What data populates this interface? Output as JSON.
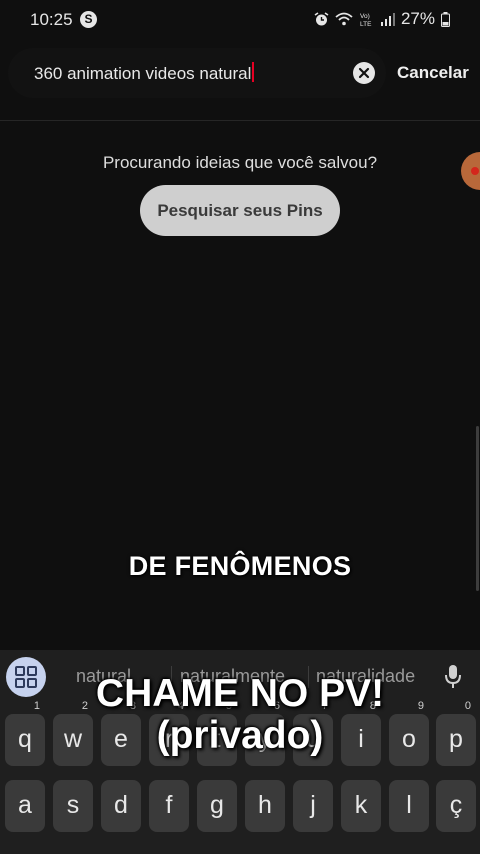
{
  "status": {
    "time": "10:25",
    "notification_badge": "S",
    "battery": "27%",
    "icons": [
      "alarm-icon",
      "wifi-icon",
      "volte-icon",
      "signal-icon",
      "battery-icon"
    ]
  },
  "search": {
    "value": "360 animation videos natural",
    "cancel_label": "Cancelar"
  },
  "content": {
    "prompt": "Procurando ideias que você salvou?",
    "search_pins_label": "Pesquisar seus Pins"
  },
  "overlay": {
    "caption_mid": "DE FENÔMENOS",
    "caption_line1": "CHAME NO PV!",
    "caption_line2": "(privado)"
  },
  "keyboard": {
    "suggestions": [
      "natural",
      "naturalmente",
      "naturalidade"
    ],
    "row1": [
      {
        "key": "q",
        "num": "1"
      },
      {
        "key": "w",
        "num": "2"
      },
      {
        "key": "e",
        "num": "3"
      },
      {
        "key": "r",
        "num": "4"
      },
      {
        "key": "t",
        "num": "5"
      },
      {
        "key": "y",
        "num": "6"
      },
      {
        "key": "u",
        "num": "7"
      },
      {
        "key": "i",
        "num": "8"
      },
      {
        "key": "o",
        "num": "9"
      },
      {
        "key": "p",
        "num": "0"
      }
    ],
    "row2": [
      "a",
      "s",
      "d",
      "f",
      "g",
      "h",
      "j",
      "k",
      "l",
      "ç"
    ]
  },
  "colors": {
    "background": "#0f0f0f",
    "caret": "#e60023",
    "pins_button": "#cfcfcf",
    "keyboard": "#1f1f1f",
    "key": "#3a3a3a"
  }
}
